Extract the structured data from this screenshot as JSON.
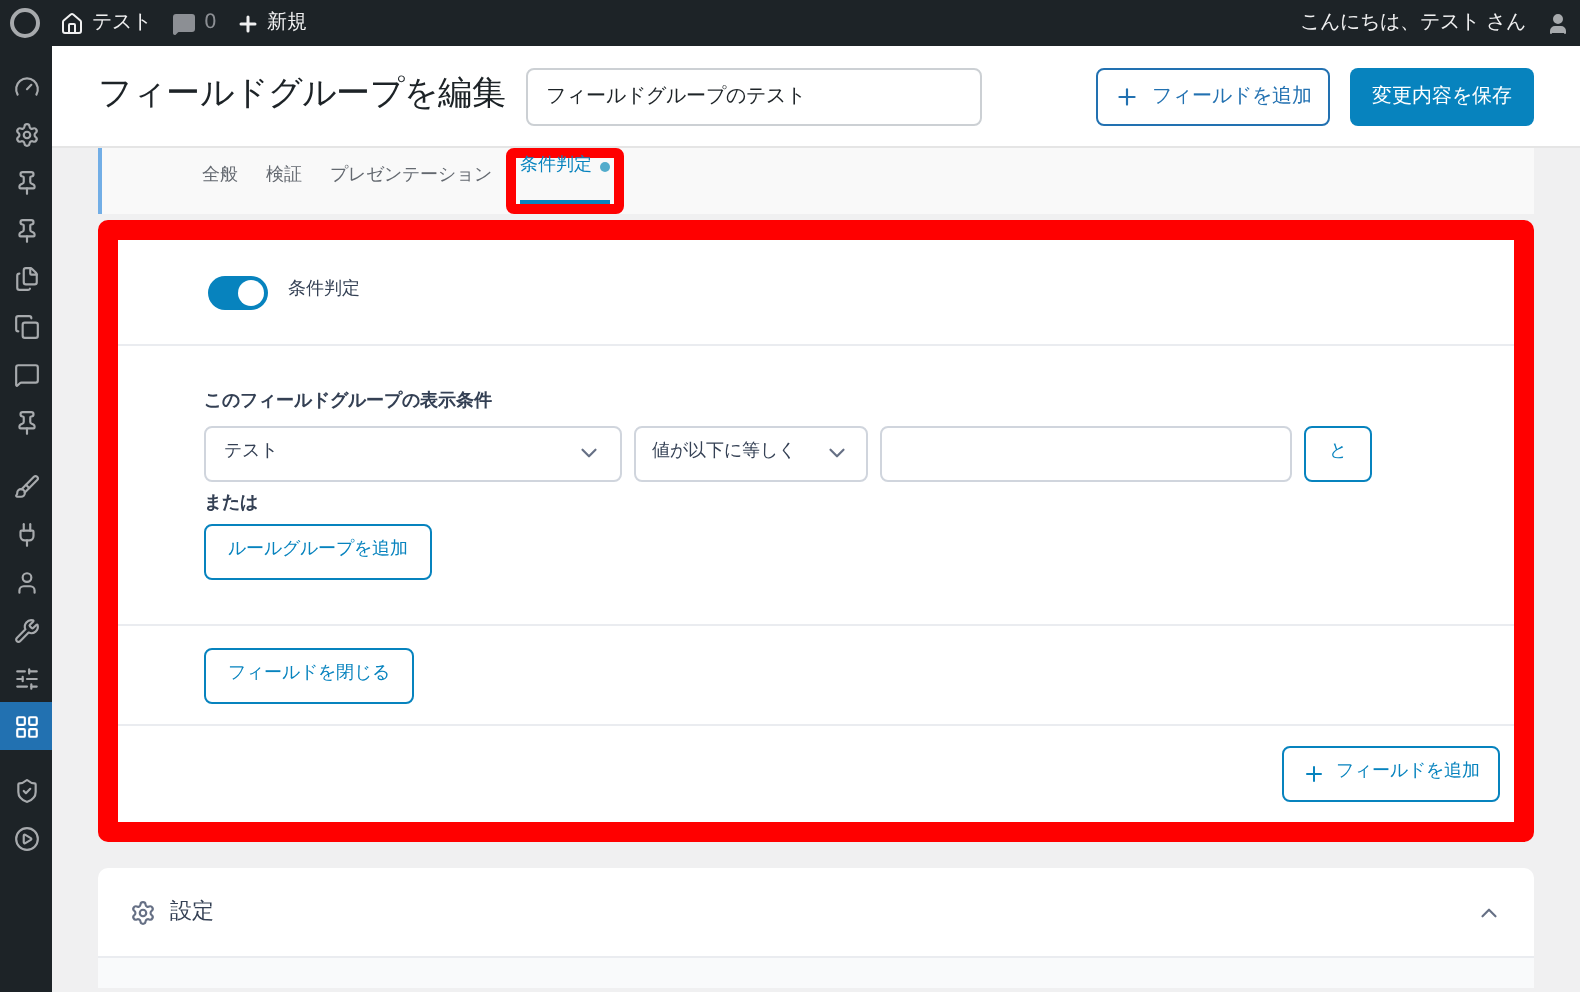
{
  "admin_bar": {
    "site": "テスト",
    "comments": "0",
    "new": "新規",
    "greeting": "こんにちは、テスト さん"
  },
  "sidebar": {
    "items": [
      {
        "selected": false
      },
      {
        "selected": false
      },
      {
        "selected": false
      },
      {
        "selected": false
      },
      {
        "selected": false
      },
      {
        "selected": false
      },
      {
        "selected": false
      },
      {
        "selected": false
      },
      {
        "selected": false
      },
      {
        "selected": false
      },
      {
        "selected": false
      },
      {
        "selected": false
      },
      {
        "selected": false
      },
      {
        "selected": true
      },
      {
        "selected": false
      },
      {
        "selected": false
      }
    ]
  },
  "header": {
    "title": "フィールドグループを編集",
    "name_field": "フィールドグループのテスト",
    "add_field_button": "フィールドを追加",
    "save_button": "変更内容を保存"
  },
  "tabs": [
    {
      "label": "全般",
      "selected": false,
      "highlighted": false
    },
    {
      "label": "検証",
      "selected": false,
      "highlighted": false
    },
    {
      "label": "プレゼンテーション",
      "selected": false,
      "highlighted": false
    },
    {
      "label": "条件判定",
      "selected": true,
      "highlighted": true
    }
  ],
  "panel": {
    "highlighted": true,
    "toggle": {
      "label": "条件判定",
      "on": true
    },
    "rules_heading": "このフィールドグループの表示条件",
    "rule": {
      "param": "テスト",
      "operator": "値が以下に等しく",
      "and_button": "と"
    },
    "or_label": "または",
    "add_rule_group": "ルールグループを追加",
    "close_fields_button": "フィールドを閉じる",
    "add_field_button": "フィールドを追加"
  },
  "settings": {
    "title": "設定",
    "expanded": true
  }
}
